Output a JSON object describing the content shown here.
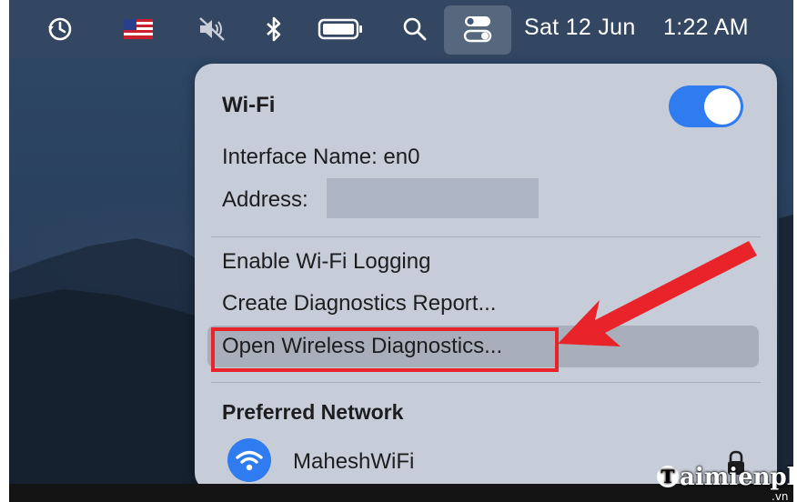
{
  "menubar": {
    "icons": [
      "time-machine-icon",
      "us-flag-icon",
      "mute-icon",
      "bluetooth-icon",
      "battery-icon",
      "search-icon",
      "control-center-icon"
    ],
    "date": "Sat 12 Jun",
    "time": "1:22 AM"
  },
  "wifi_menu": {
    "title": "Wi-Fi",
    "toggle_on": true,
    "interface_name": "Interface Name: en0",
    "address_label": "Address:",
    "options": [
      "Enable Wi-Fi Logging",
      "Create Diagnostics Report...",
      "Open Wireless Diagnostics..."
    ],
    "preferred_header": "Preferred Network",
    "network_name": "MaheshWiFi"
  },
  "colors": {
    "accent": "#2f7bf0",
    "annotation": "#e8242a"
  },
  "watermark": {
    "text": "aimienphi",
    "suffix": ".vn"
  }
}
